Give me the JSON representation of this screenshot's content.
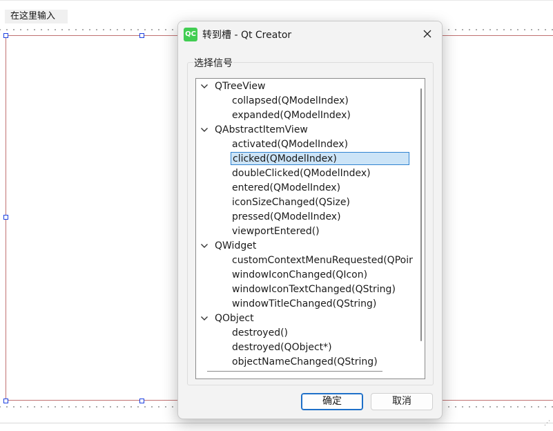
{
  "background": {
    "menu_placeholder": "在这里输入"
  },
  "dialog": {
    "logo_text": "QC",
    "title": "转到槽 - Qt Creator",
    "group_title": "选择信号",
    "tree": [
      {
        "type": "group",
        "label": "QTreeView"
      },
      {
        "type": "child",
        "label": "collapsed(QModelIndex)"
      },
      {
        "type": "child",
        "label": "expanded(QModelIndex)"
      },
      {
        "type": "group",
        "label": "QAbstractItemView"
      },
      {
        "type": "child",
        "label": "activated(QModelIndex)"
      },
      {
        "type": "child",
        "label": "clicked(QModelIndex)",
        "selected": true
      },
      {
        "type": "child",
        "label": "doubleClicked(QModelIndex)"
      },
      {
        "type": "child",
        "label": "entered(QModelIndex)"
      },
      {
        "type": "child",
        "label": "iconSizeChanged(QSize)"
      },
      {
        "type": "child",
        "label": "pressed(QModelIndex)"
      },
      {
        "type": "child",
        "label": "viewportEntered()"
      },
      {
        "type": "group",
        "label": "QWidget"
      },
      {
        "type": "child",
        "label": "customContextMenuRequested(QPoint)"
      },
      {
        "type": "child",
        "label": "windowIconChanged(QIcon)"
      },
      {
        "type": "child",
        "label": "windowIconTextChanged(QString)"
      },
      {
        "type": "child",
        "label": "windowTitleChanged(QString)"
      },
      {
        "type": "group",
        "label": "QObject"
      },
      {
        "type": "child",
        "label": "destroyed()"
      },
      {
        "type": "child",
        "label": "destroyed(QObject*)"
      },
      {
        "type": "child",
        "label": "objectNameChanged(QString)"
      }
    ],
    "ok_label": "确定",
    "cancel_label": "取消"
  },
  "colors": {
    "selection_bg": "#cce4f7",
    "selection_border": "#2f82d0",
    "qt_green": "#41cd52",
    "canvas_border": "#c07070"
  }
}
